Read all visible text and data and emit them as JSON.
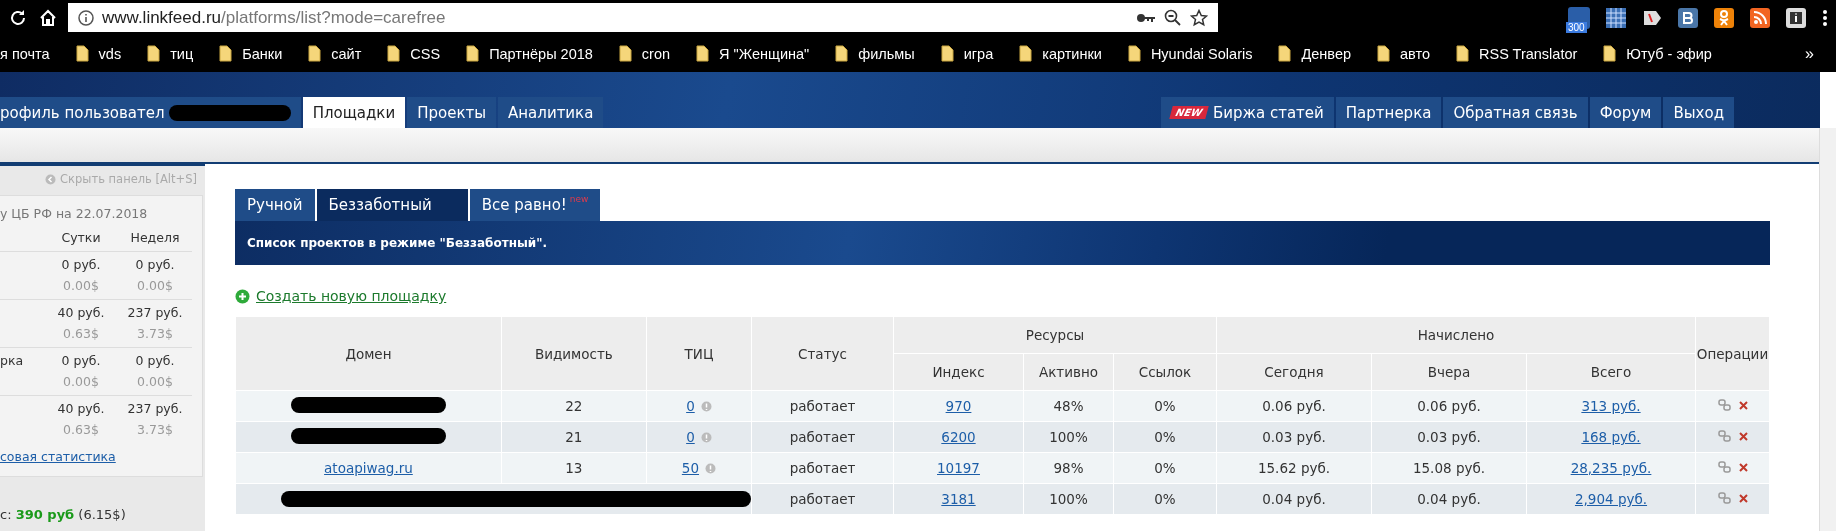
{
  "browser": {
    "url_host": "www.linkfeed.ru",
    "url_path": "/platforms/list?mode=carefree",
    "extension_badge": "300",
    "bookmarks": [
      {
        "label": "я почта",
        "folder": false
      },
      {
        "label": "vds",
        "folder": true
      },
      {
        "label": "тиц",
        "folder": true
      },
      {
        "label": "Банки",
        "folder": true
      },
      {
        "label": "сайт",
        "folder": true
      },
      {
        "label": "CSS",
        "folder": true
      },
      {
        "label": "Партнёры 2018",
        "folder": true
      },
      {
        "label": "cron",
        "folder": true
      },
      {
        "label": "Я \"Женщина\"",
        "folder": true
      },
      {
        "label": "фильмы",
        "folder": true
      },
      {
        "label": "игра",
        "folder": true
      },
      {
        "label": "картинки",
        "folder": true
      },
      {
        "label": "Hyundai Solaris",
        "folder": true
      },
      {
        "label": "Денвер",
        "folder": true
      },
      {
        "label": "авто",
        "folder": true
      },
      {
        "label": "RSS Translator",
        "folder": true
      },
      {
        "label": "Ютуб - эфир",
        "folder": true
      }
    ],
    "bookmarks_overflow": "»"
  },
  "nav_left": [
    {
      "label": "рофиль пользовател",
      "selected": false,
      "redacted": true
    },
    {
      "label": "Площадки",
      "selected": true,
      "redacted": false
    },
    {
      "label": "Проекты",
      "selected": false,
      "redacted": false
    },
    {
      "label": "Аналитика",
      "selected": false,
      "redacted": false
    }
  ],
  "nav_right": [
    {
      "label": "Биржа статей",
      "badge": "NEW"
    },
    {
      "label": "Партнерка"
    },
    {
      "label": "Обратная связь"
    },
    {
      "label": "Форум"
    },
    {
      "label": "Выход"
    }
  ],
  "sidebar": {
    "hide_panel": "Скрыть панель [Alt+S]",
    "rate_note": "у ЦБ РФ на 22.07.2018",
    "columns": [
      "Сутки",
      "Неделя"
    ],
    "rows": [
      {
        "day": "0 руб.",
        "day_usd": "0.00$",
        "week": "0 руб.",
        "week_usd": "0.00$"
      },
      {
        "day": "40 руб.",
        "day_usd": "0.63$",
        "week": "237 руб.",
        "week_usd": "3.73$"
      },
      {
        "label": "рка",
        "day": "0 руб.",
        "day_usd": "0.00$",
        "week": "0 руб.",
        "week_usd": "0.00$"
      },
      {
        "day": "40 руб.",
        "day_usd": "0.63$",
        "week": "237 руб.",
        "week_usd": "3.73$"
      }
    ],
    "stats_link": "совая статистика",
    "balance_label": "с:",
    "balance": "390 руб",
    "balance_usd": "(6.15$)"
  },
  "mode_tabs": [
    {
      "label": "Ручной",
      "selected": false
    },
    {
      "label": "Беззаботный",
      "selected": true
    },
    {
      "label": "Все равно!",
      "badge": "new",
      "selected": false
    }
  ],
  "banner": "Список проектов в режиме \"Беззаботный\".",
  "create_link": "Создать новую площадку",
  "table": {
    "columns": [
      "Домен",
      "Видимость",
      "ТИЦ",
      "Статус"
    ],
    "group_resources": "Ресурсы",
    "resources": [
      "Индекс",
      "Активно",
      "Ссылок"
    ],
    "group_accrued": "Начислено",
    "accrued": [
      "Сегодня",
      "Вчера",
      "Всего"
    ],
    "operations": "Операции",
    "rows": [
      {
        "domain_redacted": true,
        "wide_redaction": false,
        "visibility": "22",
        "tic": "0",
        "status": "работает",
        "index": "970",
        "active": "48%",
        "links": "0%",
        "today": "0.06 руб.",
        "yesterday": "0.06 руб.",
        "total": "313 руб."
      },
      {
        "domain_redacted": true,
        "wide_redaction": false,
        "visibility": "21",
        "tic": "0",
        "status": "работает",
        "index": "6200",
        "active": "100%",
        "links": "0%",
        "today": "0.03 руб.",
        "yesterday": "0.03 руб.",
        "total": "168 руб."
      },
      {
        "domain": "atoapiwag.ru",
        "domain_redacted": false,
        "wide_redaction": false,
        "visibility": "13",
        "tic": "50",
        "status": "работает",
        "index": "10197",
        "active": "98%",
        "links": "0%",
        "today": "15.62 руб.",
        "yesterday": "15.08 руб.",
        "total": "28,235 руб."
      },
      {
        "wide_redaction": true,
        "status": "работает",
        "index": "3181",
        "active": "100%",
        "links": "0%",
        "today": "0.04 руб.",
        "yesterday": "0.04 руб.",
        "total": "2,904 руб."
      }
    ]
  }
}
